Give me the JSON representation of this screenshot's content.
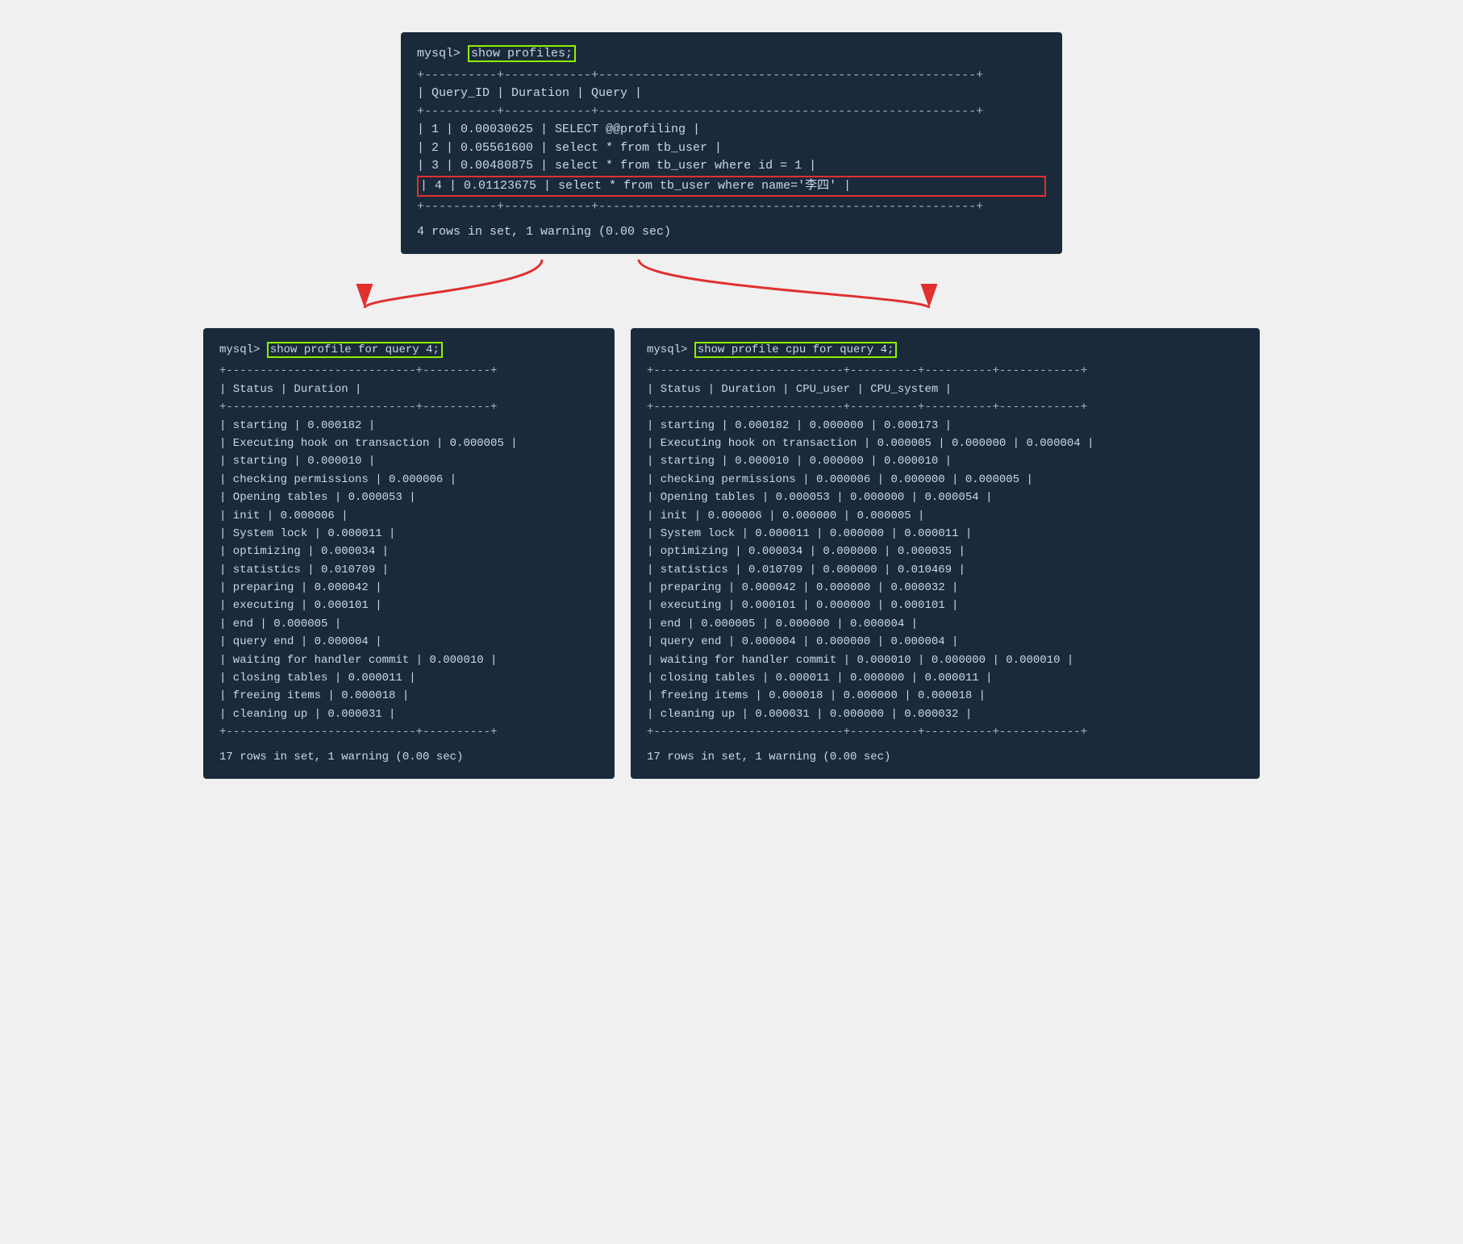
{
  "top": {
    "prompt": "mysql>",
    "command": "show profiles;",
    "separator1": "+----------+------------+----------------------------------------------------+",
    "header": "| Query_ID | Duration   | Query                                              |",
    "separator2": "+----------+------------+----------------------------------------------------+",
    "rows": [
      "| 1 | 0.00030625 | SELECT @@profiling                                      |",
      "| 2 | 0.05561600 | select * from tb_user                                   |",
      "| 3 | 0.00480875 | select * from tb_user where id = 1                      |",
      "| 4 | 0.01123675 | select * from tb_user where name='李四'              |"
    ],
    "separator3": "+----------+------------+----------------------------------------------------+",
    "footer": "4 rows in set, 1 warning (0.00 sec)"
  },
  "left": {
    "prompt": "mysql>",
    "command": "show profile for query 4;",
    "separator1": "+----------------------------+----------+",
    "header": "| Status                     | Duration |",
    "separator2": "+----------------------------+----------+",
    "rows": [
      {
        "status": "starting",
        "duration": "0.000182"
      },
      {
        "status": "Executing hook on transaction",
        "duration": "0.000005"
      },
      {
        "status": "starting",
        "duration": "0.000010"
      },
      {
        "status": "checking permissions",
        "duration": "0.000006"
      },
      {
        "status": "Opening tables",
        "duration": "0.000053"
      },
      {
        "status": "init",
        "duration": "0.000006"
      },
      {
        "status": "System lock",
        "duration": "0.000011"
      },
      {
        "status": "optimizing",
        "duration": "0.000034"
      },
      {
        "status": "statistics",
        "duration": "0.010709"
      },
      {
        "status": "preparing",
        "duration": "0.000042"
      },
      {
        "status": "executing",
        "duration": "0.000101"
      },
      {
        "status": "end",
        "duration": "0.000005"
      },
      {
        "status": "query end",
        "duration": "0.000004"
      },
      {
        "status": "waiting for handler commit",
        "duration": "0.000010"
      },
      {
        "status": "closing tables",
        "duration": "0.000011"
      },
      {
        "status": "freeing items",
        "duration": "0.000018"
      },
      {
        "status": "cleaning up",
        "duration": "0.000031"
      }
    ],
    "separator3": "+----------------------------+----------+",
    "footer": "17 rows in set, 1 warning (0.00 sec)"
  },
  "right": {
    "prompt": "mysql>",
    "command": "show profile cpu for query 4;",
    "separator1": "+----------------------------+----------+----------+------------+",
    "header": "| Status                     | Duration | CPU_user | CPU_system |",
    "separator2": "+----------------------------+----------+----------+------------+",
    "rows": [
      {
        "status": "starting",
        "duration": "0.000182",
        "cpu_user": "0.000000",
        "cpu_system": "0.000173"
      },
      {
        "status": "Executing hook on transaction",
        "duration": "0.000005",
        "cpu_user": "0.000000",
        "cpu_system": "0.000004"
      },
      {
        "status": "starting",
        "duration": "0.000010",
        "cpu_user": "0.000000",
        "cpu_system": "0.000010"
      },
      {
        "status": "checking permissions",
        "duration": "0.000006",
        "cpu_user": "0.000000",
        "cpu_system": "0.000005"
      },
      {
        "status": "Opening tables",
        "duration": "0.000053",
        "cpu_user": "0.000000",
        "cpu_system": "0.000054"
      },
      {
        "status": "init",
        "duration": "0.000006",
        "cpu_user": "0.000000",
        "cpu_system": "0.000005"
      },
      {
        "status": "System lock",
        "duration": "0.000011",
        "cpu_user": "0.000000",
        "cpu_system": "0.000011"
      },
      {
        "status": "optimizing",
        "duration": "0.000034",
        "cpu_user": "0.000000",
        "cpu_system": "0.000035"
      },
      {
        "status": "statistics",
        "duration": "0.010709",
        "cpu_user": "0.000000",
        "cpu_system": "0.010469"
      },
      {
        "status": "preparing",
        "duration": "0.000042",
        "cpu_user": "0.000000",
        "cpu_system": "0.000032"
      },
      {
        "status": "executing",
        "duration": "0.000101",
        "cpu_user": "0.000000",
        "cpu_system": "0.000101"
      },
      {
        "status": "end",
        "duration": "0.000005",
        "cpu_user": "0.000000",
        "cpu_system": "0.000004"
      },
      {
        "status": "query end",
        "duration": "0.000004",
        "cpu_user": "0.000000",
        "cpu_system": "0.000004"
      },
      {
        "status": "waiting for handler commit",
        "duration": "0.000010",
        "cpu_user": "0.000000",
        "cpu_system": "0.000010"
      },
      {
        "status": "closing tables",
        "duration": "0.000011",
        "cpu_user": "0.000000",
        "cpu_system": "0.000011"
      },
      {
        "status": "freeing items",
        "duration": "0.000018",
        "cpu_user": "0.000000",
        "cpu_system": "0.000018"
      },
      {
        "status": "cleaning up",
        "duration": "0.000031",
        "cpu_user": "0.000000",
        "cpu_system": "0.000032"
      }
    ],
    "separator3": "+----------------------------+----------+----------+------------+",
    "footer": "17 rows in set, 1 warning (0.00 sec)"
  }
}
